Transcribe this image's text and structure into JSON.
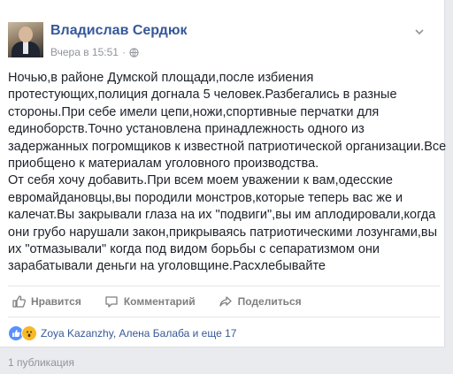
{
  "post": {
    "author": "Владислав Сердюк",
    "timestamp": "Вчера в 15:51",
    "audience_icon": "globe-icon",
    "menu_icon": "chevron-down-icon",
    "lines": [
      "Ночью,в районе Думской площади,после избиения",
      "протестующих,полиция догнала 5 человек.Разбегались в разные",
      "стороны.При себе имели цепи,ножи,спортивные перчатки для",
      "единоборств.Точно установлена принадлежность одного из",
      "задержанных погромщиков к известной патриотической организации.Все",
      "приобщено к материалам уголовного производства.",
      "От себя хочу добавить.При всем моем уважении к вам,одесские",
      "евромайдановцы,вы породили монстров,которые теперь вас же и",
      "калечат.Вы закрывали глаза на их \"подвиги\",вы им аплодировали,когда",
      "они грубо нарушали закон,прикрываясь патриотическими лозунгами,вы",
      "их \"отмазывали\" когда под видом борьбы с сепаратизмом они",
      "зарабатывали деньги на уголовщине.Расхлебывайте"
    ]
  },
  "actions": {
    "like": "Нравится",
    "comment": "Комментарий",
    "share": "Поделиться"
  },
  "reactions": {
    "text": "Zoya Kazanzhy, Алена Балаба и еще 17",
    "icons": [
      "like-icon",
      "wow-icon"
    ]
  },
  "footer": {
    "shares": "1 публикация"
  },
  "colors": {
    "link": "#365899",
    "muted": "#90949c",
    "like": "#5890ff",
    "wow": "#f7b928"
  }
}
